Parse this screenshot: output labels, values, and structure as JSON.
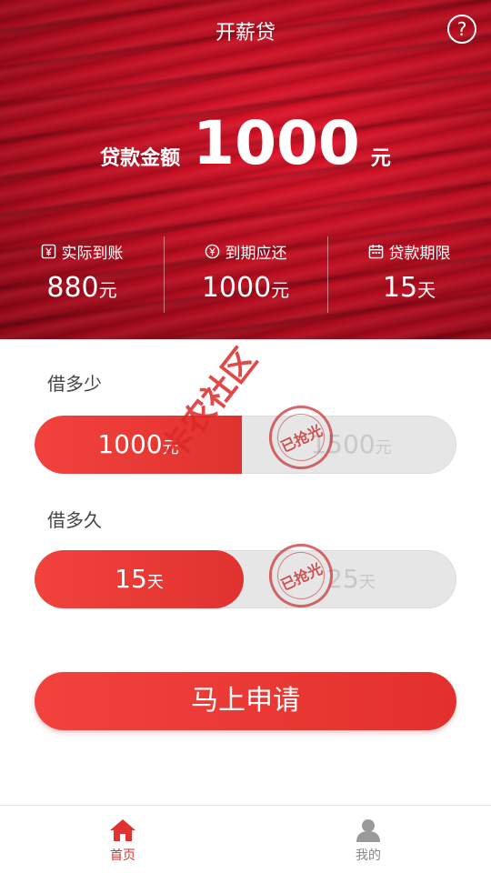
{
  "header": {
    "title": "开薪贷",
    "help_icon": "?",
    "amount_label": "贷款金额",
    "amount_value": "1000",
    "amount_unit": "元"
  },
  "stats": [
    {
      "icon": "yen-receipt-icon",
      "label": "实际到账",
      "value": "880",
      "unit": "元"
    },
    {
      "icon": "yen-coin-icon",
      "label": "到期应还",
      "value": "1000",
      "unit": "元"
    },
    {
      "icon": "calendar-icon",
      "label": "贷款期限",
      "value": "15",
      "unit": "天"
    }
  ],
  "amount_section": {
    "label": "借多少",
    "options": [
      {
        "value": "1000",
        "unit": "元",
        "selected": true
      },
      {
        "value": "1500",
        "unit": "元",
        "selected": false
      }
    ],
    "stamp": "已抢光"
  },
  "term_section": {
    "label": "借多久",
    "options": [
      {
        "value": "15",
        "unit": "天",
        "selected": true
      },
      {
        "value": "25",
        "unit": "天",
        "selected": false
      }
    ],
    "stamp": "已抢光"
  },
  "apply_button": "马上申请",
  "tabbar": {
    "home": "首页",
    "me": "我的"
  },
  "watermark": "卡农社区",
  "colors": {
    "accent": "#e0322e",
    "hero_red": "#c0101f",
    "disabled_text": "#c8c8c8"
  }
}
